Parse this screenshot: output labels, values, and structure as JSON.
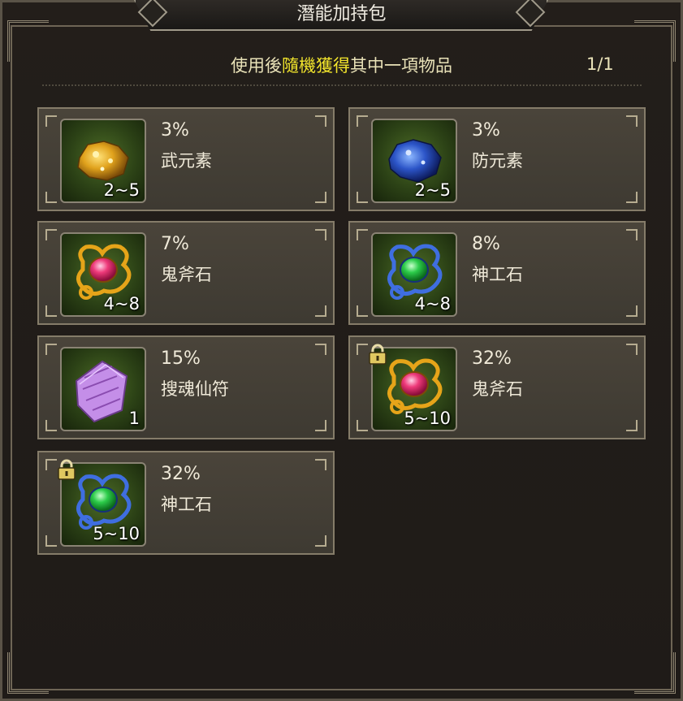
{
  "title": "潛能加持包",
  "info": {
    "prefix": "使用後",
    "highlight": "隨機獲得",
    "suffix": "其中一項物品",
    "page": "1/1"
  },
  "items": [
    {
      "percent": "3%",
      "name": "武元素",
      "qty": "2~5",
      "icon": "gold-ore-icon",
      "locked": false
    },
    {
      "percent": "3%",
      "name": "防元素",
      "qty": "2~5",
      "icon": "blue-ore-icon",
      "locked": false
    },
    {
      "percent": "7%",
      "name": "鬼斧石",
      "qty": "4~8",
      "icon": "red-gem-gold-frame-icon",
      "locked": false
    },
    {
      "percent": "8%",
      "name": "神工石",
      "qty": "4~8",
      "icon": "green-gem-blue-frame-icon",
      "locked": false
    },
    {
      "percent": "15%",
      "name": "搜魂仙符",
      "qty": "1",
      "icon": "purple-talisman-icon",
      "locked": false
    },
    {
      "percent": "32%",
      "name": "鬼斧石",
      "qty": "5~10",
      "icon": "red-gem-gold-frame-icon",
      "locked": true
    },
    {
      "percent": "32%",
      "name": "神工石",
      "qty": "5~10",
      "icon": "green-gem-blue-frame-icon",
      "locked": true
    }
  ],
  "colors": {
    "highlight": "#f2e52c",
    "text": "#efe9d8",
    "card_bg": "#46403a"
  }
}
